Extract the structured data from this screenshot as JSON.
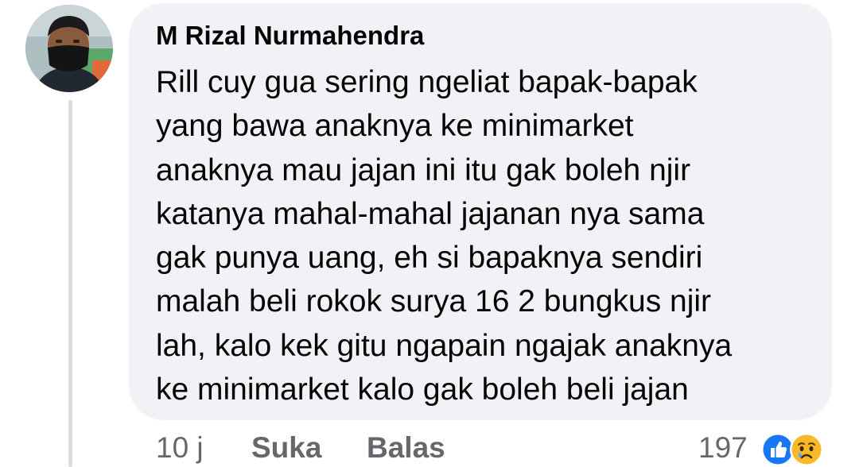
{
  "comment": {
    "author": "M Rizal Nurmahendra",
    "text": "Rill cuy gua sering ngeliat bapak-bapak\nyang bawa anaknya ke minimarket\nanaknya mau jajan ini itu gak boleh njir\nkatanya mahal-mahal jajanan nya sama\ngak punya uang, eh si bapaknya sendiri\nmalah beli rokok surya 16 2 bungkus njir\nlah, kalo kek gitu ngapain ngajak anaknya\nke minimarket kalo gak boleh beli jajan",
    "time": "10 j",
    "like_label": "Suka",
    "reply_label": "Balas",
    "reaction_count": "197",
    "reactions": [
      "like-icon",
      "sad-icon"
    ]
  },
  "colors": {
    "bubble": "#f0f2f5",
    "text": "#050505",
    "secondary_text": "#65676b",
    "like_blue": "#1877f2",
    "sad_yellow": "#f7b928"
  }
}
